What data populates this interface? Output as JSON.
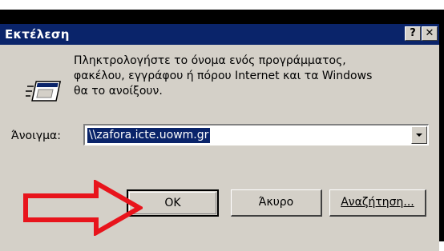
{
  "window": {
    "title": "Εκτέλεση",
    "help_glyph": "?",
    "close_glyph": "✕"
  },
  "description": {
    "line1": "Πληκτρολογήστε το όνομα ενός προγράμματος,",
    "line2": "φακέλου, εγγράφου ή πόρου Internet και τα Windows",
    "line3": "θα το ανοίξουν."
  },
  "open_field": {
    "label": "Άνοιγμα:",
    "value": "\\\\zafora.icte.uowm.gr"
  },
  "buttons": {
    "ok": "OK",
    "cancel": "Άκυρο",
    "browse": "Αναζήτηση..."
  },
  "icons": {
    "run": "run-program-icon",
    "annotation": "red-arrow-annotation"
  },
  "colors": {
    "title_bar": "#0a246a",
    "face": "#d4d0c8",
    "selection": "#0a246a",
    "annotation": "#e8141c"
  }
}
